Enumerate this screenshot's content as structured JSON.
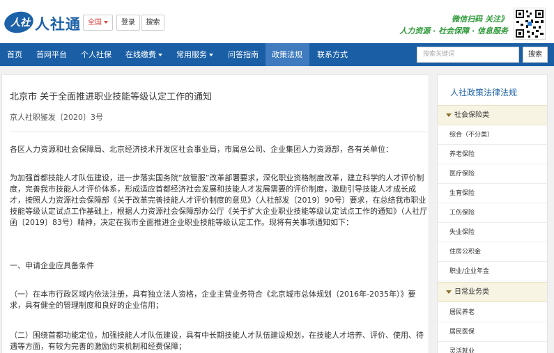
{
  "header": {
    "logo_mark": "人社",
    "logo_text": "人社通",
    "region_label": "全国",
    "login_label": "登录",
    "search_label": "搜索",
    "slogan_line1": "微信扫码 关注》",
    "slogan_line2": "人力资源 · 社会保障 · 信息服务"
  },
  "nav": {
    "items": [
      {
        "label": "首页"
      },
      {
        "label": "首网平台"
      },
      {
        "label": "个人社保"
      },
      {
        "label": "在线缴费"
      },
      {
        "label": "常用服务"
      },
      {
        "label": "问答指南"
      },
      {
        "label": "政策法规"
      },
      {
        "label": "联系方式"
      }
    ],
    "search_placeholder": "搜索关键词",
    "search_button": "搜索"
  },
  "article": {
    "title": "北京市 关于全面推进职业技能等级认定工作的通知",
    "doc_number": "京人社职鉴发〔2020〕3号",
    "paragraphs": [
      "各区人力资源和社会保障局、北京经济技术开发区社会事业局，市属总公司、企业集团人力资源部，各有关单位：",
      "为加强首都技能人才队伍建设，进一步落实国务院“放管服”改革部署要求，深化职业资格制度改革，建立科学的人才评价制度，完善我市技能人才评价体系，形成适应首都经济社会发展和技能人才发展需要的评价制度，激励引导技能人才成长成才，按照人力资源社会保障部《关于改革完善技能人才评价制度的意见》（人社部发〔2019〕90号）要求，在总结我市职业技能等级认定试点工作基础上，根据人力资源社会保障部办公厅《关于扩大企业职业技能等级认定试点工作的通知》（人社厅函〔2019〕83号）精神，决定在我市全面推进企业职业技能等级认定工作。现将有关事项通知如下：",
      "一、申请企业应具备条件",
      "（一）在本市行政区域内依法注册，具有独立法人资格，企业主营业务符合《北京城市总体规划（2016年-2035年）》要求，具有健全的管理制度和良好的企业信用；",
      "（二）围绕首都功能定位，加强技能人才队伍建设，具有中长期技能人才队伍建设规划，在技能人才培养、评价、使用、待遇等方面，有较为完善的激励约束机制和经费保障；"
    ]
  },
  "sidebar": {
    "title": "人社政策法律法规",
    "category1": "社会保险类",
    "items1": [
      {
        "label": "综合（不分类）"
      },
      {
        "label": "养老保险"
      },
      {
        "label": "医疗保险"
      },
      {
        "label": "生育保险"
      },
      {
        "label": "工伤保险"
      },
      {
        "label": "失业保险"
      },
      {
        "label": "住房公积金"
      },
      {
        "label": "职业/企业年金"
      }
    ],
    "category2": "日常业务类",
    "items2": [
      {
        "label": "居民养老"
      },
      {
        "label": "居民医保"
      },
      {
        "label": "灵活就业"
      }
    ]
  },
  "colors": {
    "brand_blue": "#1d62a8",
    "nav_blue": "#1a5fa6",
    "nav_active": "#3f7bbe",
    "slogan_green": "#2f9a3a",
    "region_red": "#d9433c"
  }
}
